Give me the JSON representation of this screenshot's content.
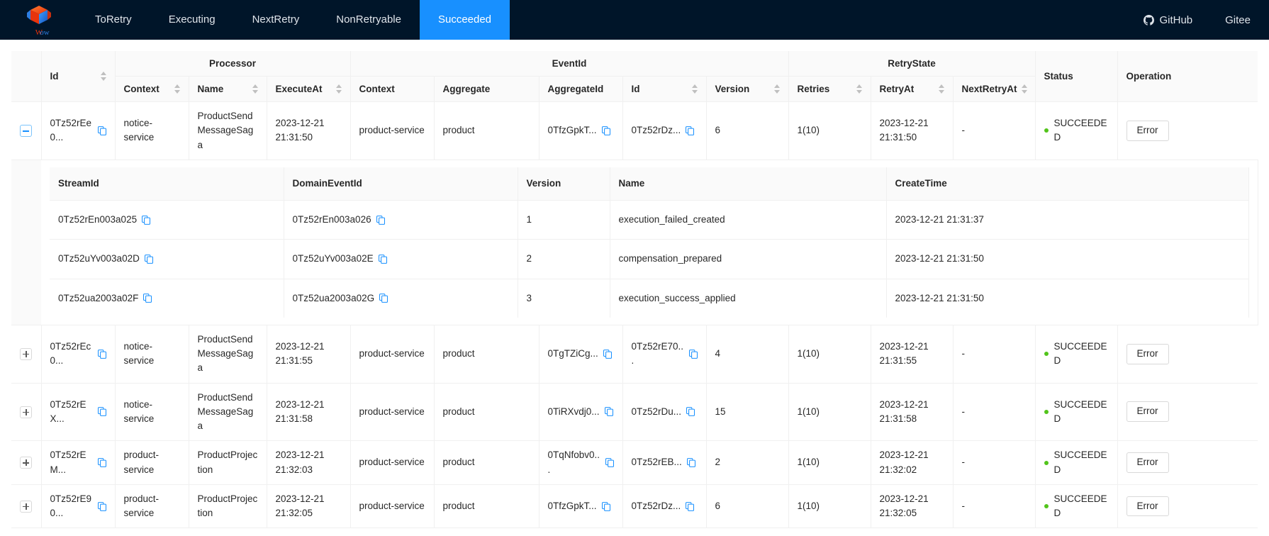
{
  "navbar": {
    "logo_alt": "Wow logo",
    "logo_caption": "Wow",
    "items": [
      {
        "label": "ToRetry",
        "active": false
      },
      {
        "label": "Executing",
        "active": false
      },
      {
        "label": "NextRetry",
        "active": false
      },
      {
        "label": "NonRetryable",
        "active": false
      },
      {
        "label": "Succeeded",
        "active": true
      }
    ],
    "links": [
      {
        "label": "GitHub",
        "icon": "github-icon"
      },
      {
        "label": "Gitee",
        "icon": null
      }
    ],
    "background": "#001529",
    "active_color": "#1890ff"
  },
  "table": {
    "group_headers": {
      "id": "Id",
      "processor": "Processor",
      "event_id": "EventId",
      "retry_state": "RetryState",
      "status": "Status",
      "operation": "Operation"
    },
    "leaf_headers": {
      "processor_context": "Context",
      "processor_name": "Name",
      "processor_execute_at": "ExecuteAt",
      "event_context": "Context",
      "event_aggregate": "Aggregate",
      "event_aggregate_id": "AggregateId",
      "event_id": "Id",
      "event_version": "Version",
      "retries": "Retries",
      "retry_at": "RetryAt",
      "next_retry_at": "NextRetryAt"
    },
    "sortable": [
      "Id",
      "Context",
      "Name",
      "ExecuteAt",
      "Id",
      "Version",
      "Retries",
      "RetryAt",
      "NextRetryAt"
    ],
    "operation_button_label": "Error",
    "status_dot_color": "#52c41a",
    "rows": [
      {
        "expanded": true,
        "id": "0Tz52rEe0...",
        "processor_context": "notice-service",
        "processor_name": "ProductSendMessageSaga",
        "processor_execute_at": "2023-12-21 21:31:50",
        "event_context": "product-service",
        "event_aggregate": "product",
        "event_aggregate_id": "0TfzGpkT...",
        "event_id": "0Tz52rDz...",
        "event_version": "6",
        "retries": "1(10)",
        "retry_at": "2023-12-21 21:31:50",
        "next_retry_at": "-",
        "status": "SUCCEEDED"
      },
      {
        "expanded": false,
        "id": "0Tz52rEc0...",
        "processor_context": "notice-service",
        "processor_name": "ProductSendMessageSaga",
        "processor_execute_at": "2023-12-21 21:31:55",
        "event_context": "product-service",
        "event_aggregate": "product",
        "event_aggregate_id": "0TgTZiCg...",
        "event_id": "0Tz52rE70...",
        "event_version": "4",
        "retries": "1(10)",
        "retry_at": "2023-12-21 21:31:55",
        "next_retry_at": "-",
        "status": "SUCCEEDED"
      },
      {
        "expanded": false,
        "id": "0Tz52rEX...",
        "processor_context": "notice-service",
        "processor_name": "ProductSendMessageSaga",
        "processor_execute_at": "2023-12-21 21:31:58",
        "event_context": "product-service",
        "event_aggregate": "product",
        "event_aggregate_id": "0TiRXvdj0...",
        "event_id": "0Tz52rDu...",
        "event_version": "15",
        "retries": "1(10)",
        "retry_at": "2023-12-21 21:31:58",
        "next_retry_at": "-",
        "status": "SUCCEEDED"
      },
      {
        "expanded": false,
        "id": "0Tz52rEM...",
        "processor_context": "product-service",
        "processor_name": "ProductProjection",
        "processor_execute_at": "2023-12-21 21:32:03",
        "event_context": "product-service",
        "event_aggregate": "product",
        "event_aggregate_id": "0TqNfobv0...",
        "event_id": "0Tz52rEB...",
        "event_version": "2",
        "retries": "1(10)",
        "retry_at": "2023-12-21 21:32:02",
        "next_retry_at": "-",
        "status": "SUCCEEDED"
      },
      {
        "expanded": false,
        "id": "0Tz52rE90...",
        "processor_context": "product-service",
        "processor_name": "ProductProjection",
        "processor_execute_at": "2023-12-21 21:32:05",
        "event_context": "product-service",
        "event_aggregate": "product",
        "event_aggregate_id": "0TfzGpkT...",
        "event_id": "0Tz52rDz...",
        "event_version": "6",
        "retries": "1(10)",
        "retry_at": "2023-12-21 21:32:05",
        "next_retry_at": "-",
        "status": "SUCCEEDED"
      }
    ]
  },
  "sub_table": {
    "headers": {
      "stream_id": "StreamId",
      "domain_event_id": "DomainEventId",
      "version": "Version",
      "name": "Name",
      "create_time": "CreateTime"
    },
    "rows": [
      {
        "stream_id": "0Tz52rEn003a025",
        "domain_event_id": "0Tz52rEn003a026",
        "version": "1",
        "name": "execution_failed_created",
        "create_time": "2023-12-21 21:31:37"
      },
      {
        "stream_id": "0Tz52uYv003a02D",
        "domain_event_id": "0Tz52uYv003a02E",
        "version": "2",
        "name": "compensation_prepared",
        "create_time": "2023-12-21 21:31:50"
      },
      {
        "stream_id": "0Tz52ua2003a02F",
        "domain_event_id": "0Tz52ua2003a02G",
        "version": "3",
        "name": "execution_success_applied",
        "create_time": "2023-12-21 21:31:50"
      }
    ]
  }
}
